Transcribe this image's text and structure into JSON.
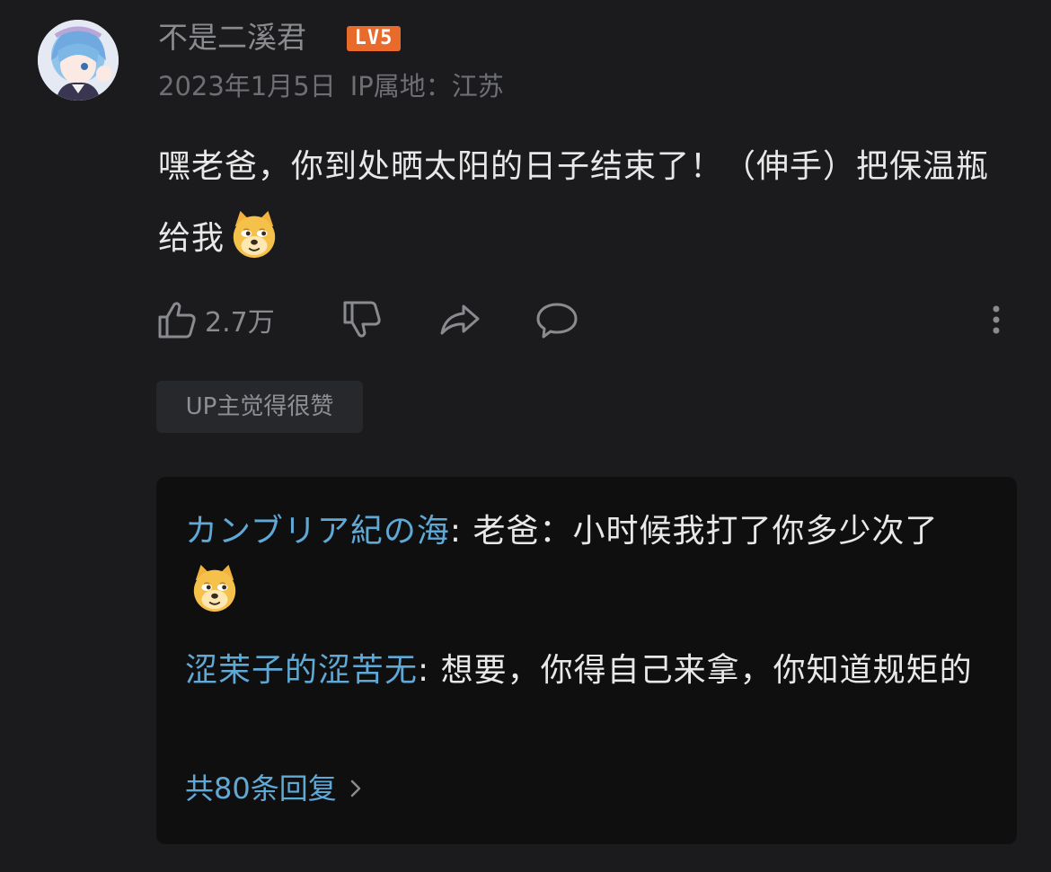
{
  "comment": {
    "username": "不是二溪君",
    "level": "LV5",
    "date": "2023年1月5日",
    "ip_location": "IP属地：江苏",
    "text": "嘿老爸，你到处晒太阳的日子结束了！（伸手）把保温瓶给我",
    "emoji": "doge-emoji"
  },
  "actions": {
    "like_count": "2.7万",
    "like_icon": "thumbs-up-icon",
    "dislike_icon": "thumbs-down-icon",
    "share_icon": "share-icon",
    "reply_icon": "comment-icon",
    "more_icon": "more-vertical-icon"
  },
  "up_tag": "UP主觉得很赞",
  "replies": [
    {
      "author": "カンブリア紀の海",
      "separator": ": ",
      "text": "老爸：小时候我打了你多少次了",
      "emoji": "doge-emoji"
    },
    {
      "author": "涩茉子的涩苦无",
      "separator": ": ",
      "text": "想要，你得自己来拿，你知道规矩的"
    }
  ],
  "reply_total": "共80条回复",
  "colors": {
    "background": "#1b1b1d",
    "reply_box": "#0f0f10",
    "link_blue": "#5fa9d6",
    "level_orange": "#e96b2c",
    "muted": "#8a8b8f"
  }
}
